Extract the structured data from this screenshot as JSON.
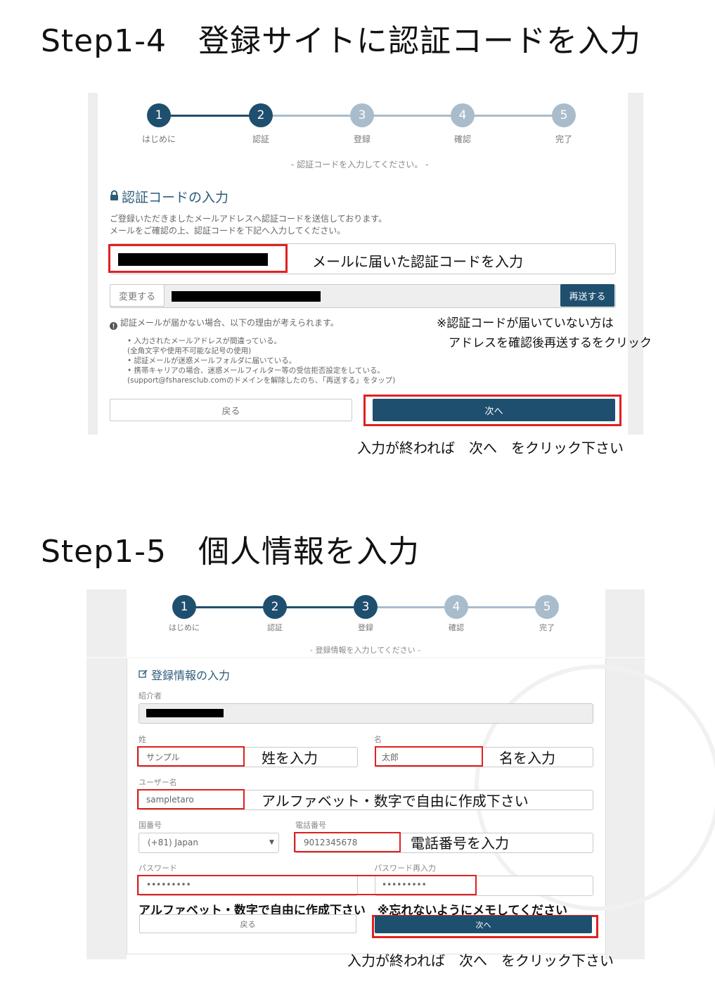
{
  "step4": {
    "heading": "Step1-4　登録サイトに認証コードを入力",
    "steps": [
      {
        "num": "1",
        "label": "はじめに"
      },
      {
        "num": "2",
        "label": "認証"
      },
      {
        "num": "3",
        "label": "登録"
      },
      {
        "num": "4",
        "label": "確認"
      },
      {
        "num": "5",
        "label": "完了"
      }
    ],
    "subtitle": "- 認証コードを入力してください。 -",
    "section_title": "認証コードの入力",
    "intro_line1": "ご登録いただきましたメールアドレスへ認証コードを送信しております。",
    "intro_line2": "メールをご確認の上、認証コードを下記へ入力してください。",
    "code_annotation": "メールに届いた認証コードを入力",
    "change_button": "変更する",
    "resend_button": "再送する",
    "notice_title": "認証メールが届かない場合、以下の理由が考えられます。",
    "reasons": [
      "•  入力されたメールアドレスが間違っている。",
      "    (全角文字や使用不可能な記号の使用)",
      "•  認証メールが迷惑メールフォルダに届いている。",
      "•  携帯キャリアの場合、迷惑メールフィルター等の受信拒否設定をしている。",
      "    (support@fsharesclub.comのドメインを解除したのち、「再送する」をタップ)"
    ],
    "resend_note_line1": "※認証コードが届いていない方は",
    "resend_note_line2": "アドレスを確認後再送するをクリック",
    "back_button": "戻る",
    "next_button": "次へ",
    "next_annotation": "入力が終われば　次へ　をクリック下さい"
  },
  "step5": {
    "heading": "Step1-5　個人情報を入力",
    "steps": [
      {
        "num": "1",
        "label": "はじめに"
      },
      {
        "num": "2",
        "label": "認証"
      },
      {
        "num": "3",
        "label": "登録"
      },
      {
        "num": "4",
        "label": "確認"
      },
      {
        "num": "5",
        "label": "完了"
      }
    ],
    "subtitle": "- 登録情報を入力してください -",
    "section_title": "登録情報の入力",
    "referrer_label": "紹介者",
    "last_name_label": "姓",
    "last_name_value": "サンプル",
    "last_name_annotation": "姓を入力",
    "first_name_label": "名",
    "first_name_value": "太郎",
    "first_name_annotation": "名を入力",
    "username_label": "ユーザー名",
    "username_value": "sampletaro",
    "username_annotation": "アルファベット・数字で自由に作成下さい",
    "country_label": "国番号",
    "country_value": "(+81) Japan",
    "phone_label": "電話番号",
    "phone_value": "9012345678",
    "phone_annotation": "電話番号を入力",
    "password_label": "パスワード",
    "password_value": "•••••••••",
    "password_confirm_label": "パスワード再入力",
    "password_confirm_value": "•••••••••",
    "password_annotation": "アルファベット・数字で自由に作成下さい　※忘れないようにメモしてください",
    "back_button": "戻る",
    "next_button": "次へ",
    "next_annotation": "入力が終われば　次へ　をクリック下さい"
  }
}
